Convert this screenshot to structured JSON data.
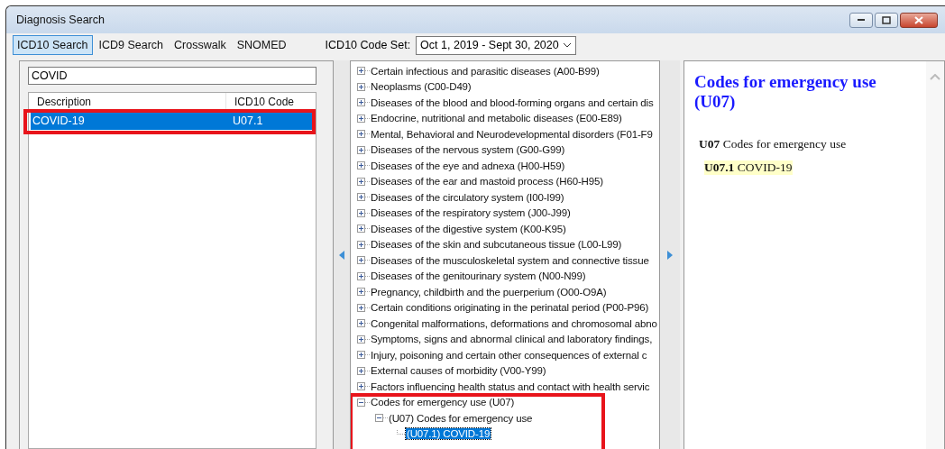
{
  "window": {
    "title": "Diagnosis Search"
  },
  "tabs": [
    {
      "label": "ICD10 Search",
      "selected": true
    },
    {
      "label": "ICD9 Search",
      "selected": false
    },
    {
      "label": "Crosswalk",
      "selected": false
    },
    {
      "label": "SNOMED",
      "selected": false
    }
  ],
  "code_set": {
    "label": "ICD10 Code Set:",
    "value": "Oct 1, 2019 - Sept 30, 2020"
  },
  "search": {
    "value": "COVID"
  },
  "results": {
    "columns": [
      "Description",
      "ICD10 Code"
    ],
    "rows": [
      {
        "cells": [
          "COVID-19",
          "U07.1"
        ],
        "selected": true
      }
    ]
  },
  "tree": [
    {
      "label": "Certain infectious and parasitic diseases (A00-B99)",
      "expanded": false,
      "selected": false
    },
    {
      "label": "Neoplasms (C00-D49)",
      "expanded": false,
      "selected": false
    },
    {
      "label": "Diseases of the blood and blood-forming organs and certain dis",
      "expanded": false,
      "selected": false
    },
    {
      "label": "Endocrine, nutritional and metabolic diseases (E00-E89)",
      "expanded": false,
      "selected": false
    },
    {
      "label": "Mental, Behavioral and Neurodevelopmental disorders (F01-F9",
      "expanded": false,
      "selected": false
    },
    {
      "label": "Diseases of the nervous system (G00-G99)",
      "expanded": false,
      "selected": false
    },
    {
      "label": "Diseases of the eye and adnexa (H00-H59)",
      "expanded": false,
      "selected": false
    },
    {
      "label": "Diseases of the ear and mastoid process (H60-H95)",
      "expanded": false,
      "selected": false
    },
    {
      "label": "Diseases of the circulatory system (I00-I99)",
      "expanded": false,
      "selected": false
    },
    {
      "label": "Diseases of the respiratory system (J00-J99)",
      "expanded": false,
      "selected": false
    },
    {
      "label": "Diseases of the digestive system (K00-K95)",
      "expanded": false,
      "selected": false
    },
    {
      "label": "Diseases of the skin and subcutaneous tissue (L00-L99)",
      "expanded": false,
      "selected": false
    },
    {
      "label": "Diseases of the musculoskeletal system and connective tissue",
      "expanded": false,
      "selected": false
    },
    {
      "label": "Diseases of the genitourinary system (N00-N99)",
      "expanded": false,
      "selected": false
    },
    {
      "label": "Pregnancy, childbirth and the puerperium (O00-O9A)",
      "expanded": false,
      "selected": false
    },
    {
      "label": "Certain conditions originating in the perinatal period (P00-P96)",
      "expanded": false,
      "selected": false
    },
    {
      "label": "Congenital malformations, deformations and chromosomal abno",
      "expanded": false,
      "selected": false
    },
    {
      "label": "Symptoms, signs and abnormal clinical and laboratory findings,",
      "expanded": false,
      "selected": false
    },
    {
      "label": "Injury, poisoning and certain other consequences of external c",
      "expanded": false,
      "selected": false
    },
    {
      "label": "External causes of morbidity (V00-Y99)",
      "expanded": false,
      "selected": false
    },
    {
      "label": "Factors influencing health status and contact with health servic",
      "expanded": false,
      "selected": false
    },
    {
      "label": "Codes for emergency use (U07)",
      "expanded": true,
      "selected": false,
      "children": [
        {
          "label": "(U07) Codes for emergency use",
          "expanded": true,
          "selected": false,
          "children": [
            {
              "label": "(U07.1) COVID-19",
              "selected": true
            }
          ]
        }
      ]
    }
  ],
  "detail": {
    "heading": "Codes for emergency use (U07)",
    "lines": [
      {
        "text": "**U07** Codes for emergency use",
        "highlighted": false,
        "children": [
          {
            "text": "**U07.1** COVID-19",
            "highlighted": true
          }
        ]
      }
    ]
  }
}
